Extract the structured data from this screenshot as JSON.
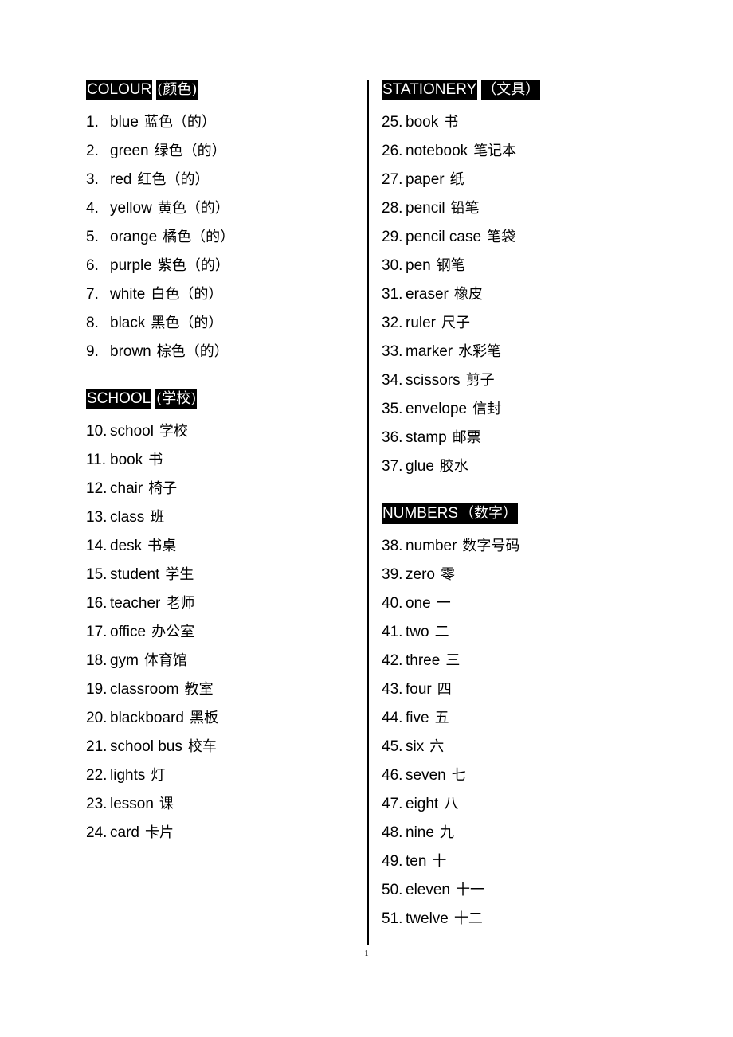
{
  "document": {
    "page_number": "1",
    "divider": true
  },
  "columns": {
    "left": [
      {
        "id": "colour",
        "heading_en": "COLOUR",
        "heading_zh": "(颜色)",
        "heading_gap": "normal",
        "entries": [
          {
            "num": "1.",
            "en": "blue",
            "zh": "蓝色（的）"
          },
          {
            "num": "2.",
            "en": "green",
            "zh": "绿色（的）"
          },
          {
            "num": "3.",
            "en": "red",
            "zh": "红色（的）"
          },
          {
            "num": "4.",
            "en": "yellow",
            "zh": "黄色（的）"
          },
          {
            "num": "5.",
            "en": "orange",
            "zh": "橘色（的）"
          },
          {
            "num": "6.",
            "en": "purple",
            "zh": "紫色（的）"
          },
          {
            "num": "7.",
            "en": "white",
            "zh": "白色（的）"
          },
          {
            "num": "8.",
            "en": "black",
            "zh": "黑色（的）"
          },
          {
            "num": "9.",
            "en": "brown",
            "zh": "棕色（的）"
          }
        ]
      },
      {
        "id": "school",
        "heading_en": "SCHOOL",
        "heading_zh": "(学校)",
        "heading_gap": "normal",
        "entries": [
          {
            "num": "10.",
            "en": "school",
            "zh": "学校"
          },
          {
            "num": "11.",
            "en": "book",
            "zh": "书"
          },
          {
            "num": "12.",
            "en": "chair",
            "zh": "椅子"
          },
          {
            "num": "13.",
            "en": "class",
            "zh": "班"
          },
          {
            "num": "14.",
            "en": "desk",
            "zh": "书桌"
          },
          {
            "num": "15.",
            "en": "student",
            "zh": "学生"
          },
          {
            "num": "16.",
            "en": "teacher",
            "zh": "老师"
          },
          {
            "num": "17.",
            "en": "office",
            "zh": "办公室"
          },
          {
            "num": "18.",
            "en": "gym",
            "zh": "体育馆"
          },
          {
            "num": "19.",
            "en": "classroom",
            "zh": "教室"
          },
          {
            "num": "20.",
            "en": "blackboard",
            "zh": "黑板"
          },
          {
            "num": "21.",
            "en": "school bus",
            "zh": "校车"
          },
          {
            "num": "22.",
            "en": "lights",
            "zh": "灯"
          },
          {
            "num": "23.",
            "en": "lesson",
            "zh": "课"
          },
          {
            "num": "24.",
            "en": "card",
            "zh": "卡片"
          }
        ]
      }
    ],
    "right": [
      {
        "id": "stationery",
        "heading_en": "STATIONERY",
        "heading_zh": "（文具）",
        "heading_gap": "normal",
        "entries": [
          {
            "num": "25.",
            "en": "book",
            "zh": "书"
          },
          {
            "num": "26.",
            "en": "notebook",
            "zh": "笔记本"
          },
          {
            "num": "27.",
            "en": "paper",
            "zh": "纸"
          },
          {
            "num": "28.",
            "en": "pencil",
            "zh": "铅笔"
          },
          {
            "num": "29.",
            "en": "pencil case",
            "zh": "笔袋"
          },
          {
            "num": "30.",
            "en": "pen",
            "zh": "钢笔"
          },
          {
            "num": "31.",
            "en": "eraser",
            "zh": "橡皮"
          },
          {
            "num": "32.",
            "en": "ruler",
            "zh": "尺子"
          },
          {
            "num": "33.",
            "en": "marker",
            "zh": "水彩笔"
          },
          {
            "num": "34.",
            "en": "scissors",
            "zh": "剪子"
          },
          {
            "num": "35.",
            "en": "envelope",
            "zh": "信封"
          },
          {
            "num": "36.",
            "en": "stamp",
            "zh": "邮票"
          },
          {
            "num": "37.",
            "en": "glue",
            "zh": "胶水"
          }
        ]
      },
      {
        "id": "numbers",
        "heading_en": "NUMBERS",
        "heading_zh": "（数字）",
        "heading_gap": "tight",
        "entries": [
          {
            "num": "38.",
            "en": "number",
            "zh": "数字号码"
          },
          {
            "num": "39.",
            "en": "zero",
            "zh": "零"
          },
          {
            "num": "40.",
            "en": "one",
            "zh": "一"
          },
          {
            "num": "41.",
            "en": "two",
            "zh": "二"
          },
          {
            "num": "42.",
            "en": "three",
            "zh": "三"
          },
          {
            "num": "43.",
            "en": "four",
            "zh": "四"
          },
          {
            "num": "44.",
            "en": "five",
            "zh": "五"
          },
          {
            "num": "45.",
            "en": "six",
            "zh": "六"
          },
          {
            "num": "46.",
            "en": "seven",
            "zh": "七"
          },
          {
            "num": "47.",
            "en": "eight",
            "zh": "八"
          },
          {
            "num": "48.",
            "en": "nine",
            "zh": "九"
          },
          {
            "num": "49.",
            "en": "ten",
            "zh": "十"
          },
          {
            "num": "50.",
            "en": "eleven",
            "zh": "十一"
          },
          {
            "num": "51.",
            "en": "twelve",
            "zh": "十二"
          }
        ]
      }
    ]
  }
}
